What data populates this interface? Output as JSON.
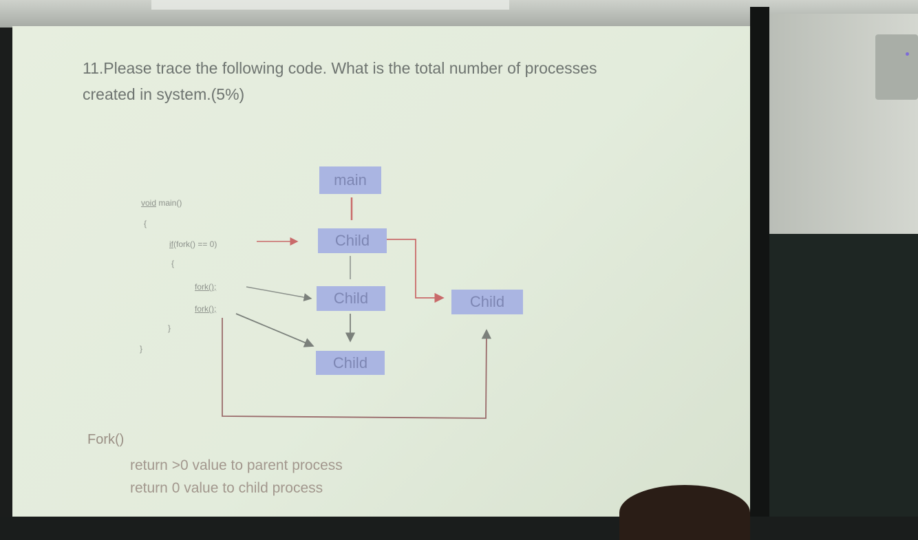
{
  "slide": {
    "question_line1": "11.Please trace the following code. What is the total number of   processes",
    "question_line2": "created in system.(5%)"
  },
  "code": {
    "line1_keyword": "void",
    "line1_rest": " main()",
    "line2": "{",
    "line3_keyword": "if",
    "line3_rest": "(fork() == 0)",
    "line4": "{",
    "line5": "fork();",
    "line6": "fork();",
    "line7": "}",
    "line8": "}"
  },
  "diagram": {
    "main": "main",
    "child1": "Child",
    "child2": "Child",
    "child3": "Child",
    "child4": "Child"
  },
  "legend": {
    "title": "Fork()",
    "line1": "return >0 value to parent process",
    "line2": "return 0    value to child process"
  },
  "colors": {
    "box": "#aab5e2",
    "arrow_red": "#c96a6a",
    "arrow_gray": "#8a8f8a"
  }
}
